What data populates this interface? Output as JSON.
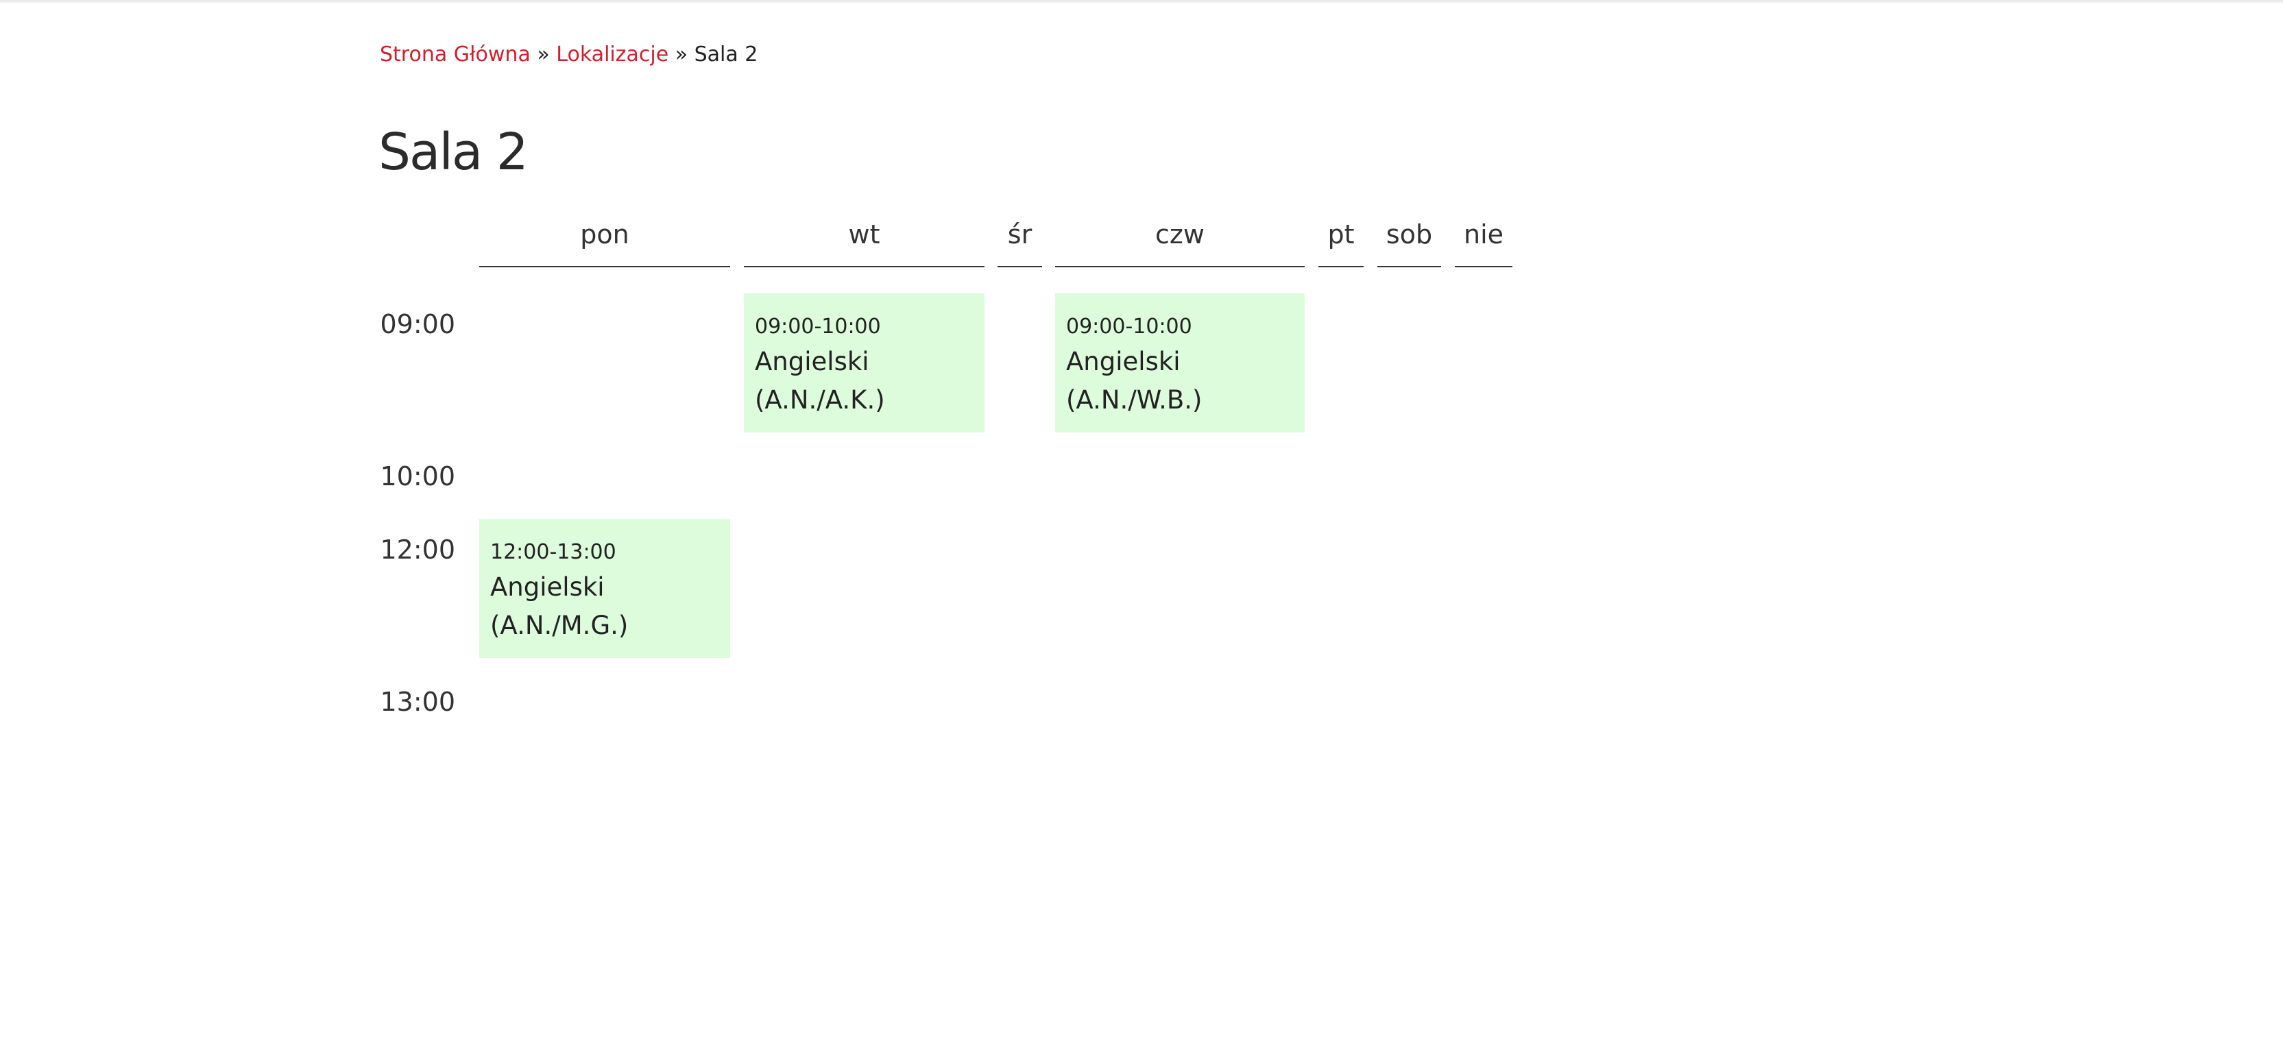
{
  "breadcrumb": {
    "home": "Strona Główna",
    "sep1": "»",
    "locations": "Lokalizacje",
    "sep2": "»",
    "current": "Sala 2"
  },
  "page_title": "Sala 2",
  "days": [
    "pon",
    "wt",
    "śr",
    "czw",
    "pt",
    "sob",
    "nie"
  ],
  "times": [
    "09:00",
    "10:00",
    "12:00",
    "13:00"
  ],
  "events": [
    {
      "day": "wt",
      "time": "09:00-10:00",
      "subject": "Angielski",
      "group": "(A.N./A.K.)"
    },
    {
      "day": "czw",
      "time": "09:00-10:00",
      "subject": "Angielski",
      "group": "(A.N./W.B.)"
    },
    {
      "day": "pon",
      "time": "12:00-13:00",
      "subject": "Angielski",
      "group": "(A.N./M.G.)"
    }
  ],
  "colors": {
    "link": "#d0202c",
    "event_bg": "#dcfcdc"
  }
}
